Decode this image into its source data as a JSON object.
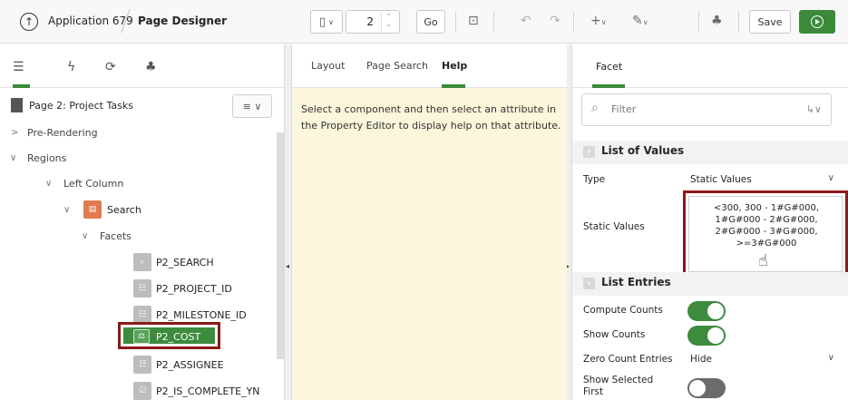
{
  "header": {
    "app_name": "Application 679",
    "page_designer": "Page Designer",
    "page_number": "2",
    "go_label": "Go",
    "save_label": "Save"
  },
  "left_pane": {
    "page_title": "Page 2: Project Tasks",
    "tree": {
      "pre_rendering": "Pre-Rendering",
      "regions": "Regions",
      "left_column": "Left Column",
      "search": "Search",
      "facets": "Facets",
      "items": [
        {
          "label": "P2_SEARCH",
          "icon": "search-facet-icon"
        },
        {
          "label": "P2_PROJECT_ID",
          "icon": "list-facet-icon"
        },
        {
          "label": "P2_MILESTONE_ID",
          "icon": "list-facet-icon"
        },
        {
          "label": "P2_COST",
          "icon": "range-facet-icon",
          "selected": true
        },
        {
          "label": "P2_ASSIGNEE",
          "icon": "list-facet-icon"
        },
        {
          "label": "P2_IS_COMPLETE_YN",
          "icon": "checkbox-facet-icon"
        }
      ]
    }
  },
  "center_pane": {
    "tabs": [
      "Layout",
      "Page Search",
      "Help"
    ],
    "active_tab": "Help",
    "help_text": "Select a component and then select an attribute in the Property Editor to display help on that attribute."
  },
  "right_pane": {
    "tab": "Facet",
    "filter_placeholder": "Filter",
    "list_of_values": {
      "title": "List of Values",
      "type_label": "Type",
      "type_value": "Static Values",
      "static_values_label": "Static Values",
      "static_values_value": "<300, 300 - 1#G#000, 1#G#000 - 2#G#000, 2#G#000 - 3#G#000, >=3#G#000"
    },
    "list_entries": {
      "title": "List Entries",
      "compute_counts_label": "Compute Counts",
      "compute_counts": true,
      "show_counts_label": "Show Counts",
      "show_counts": true,
      "zero_count_label": "Zero Count Entries",
      "zero_count_value": "Hide",
      "show_selected_label": "Show Selected First",
      "show_selected_first": false
    }
  },
  "colors": {
    "accent_green": "#3a8a3a",
    "highlight_border": "#8b1a1a",
    "help_background": "#fcf6dc"
  }
}
